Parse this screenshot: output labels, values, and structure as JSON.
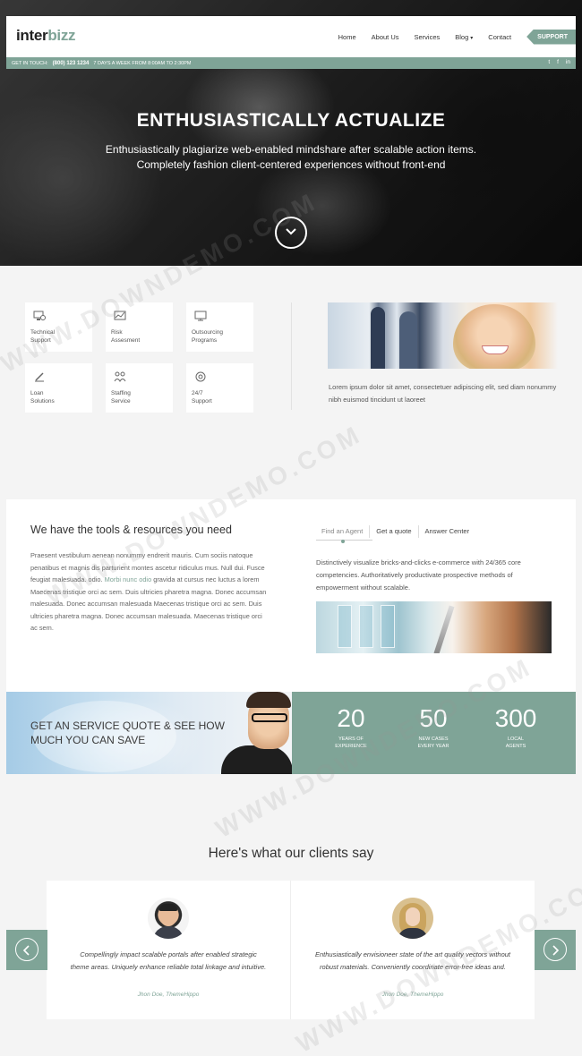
{
  "brand": {
    "logo_main": "inter",
    "logo_accent": "bizz",
    "accent_color": "#7fa497"
  },
  "nav": {
    "items": [
      "Home",
      "About Us",
      "Services",
      "Blog",
      "Contact"
    ],
    "blog_caret": "▾",
    "support_label": "SUPPORT"
  },
  "topbar": {
    "get_in_touch": "GET IN TOUCH:",
    "phone": "(800) 123 1234",
    "hours": "7 DAYS A WEEK FROM 8:00AM TO 2:30PM",
    "social": [
      "twitter-icon",
      "facebook-icon",
      "linkedin-icon"
    ],
    "social_glyphs": [
      "t",
      "f",
      "in"
    ]
  },
  "hero": {
    "title": "ENTHUSIASTICALLY ACTUALIZE",
    "subtitle_line1": "Enthusiastically plagiarize web-enabled mindshare after scalable action items.",
    "subtitle_line2": "Completely fashion client-centered experiences without front-end"
  },
  "services": {
    "cards": [
      {
        "label": "Technical\nSupport",
        "icon": "monitor-support-icon"
      },
      {
        "label": "Risk\nAssesment",
        "icon": "chart-icon"
      },
      {
        "label": "Outsourcing\nPrograms",
        "icon": "screen-icon"
      },
      {
        "label": "Loan\nSolutions",
        "icon": "pen-icon"
      },
      {
        "label": "Staffing\nService",
        "icon": "people-icon"
      },
      {
        "label": "24/7\nSupport",
        "icon": "lifebuoy-icon"
      }
    ],
    "text": "Lorem ipsum dolor sit amet, consectetuer adipiscing elit, sed diam nonummy nibh euismod tincidunt ut laoreet"
  },
  "tools": {
    "heading": "We have the tools & resources you need",
    "para_before_link": "Praesent vestibulum aenean nonummy endrerit mauris. Cum sociis natoque penatibus et magnis dis parturient montes ascetur ridiculus mus. Null dui. Fusce feugiat malesuada. odio. ",
    "para_link": "Morbi nunc odio",
    "para_after_link": " gravida at cursus nec luctus a lorem Maecenas tristique orci ac sem. Duis ultricies pharetra magna. Donec accumsan malesuada. Donec accumsan malesuada Maecenas tristique orci ac sem. Duis ultricies pharetra magna. Donec accumsan malesuada. Maecenas tristique orci ac sem.",
    "tabs": [
      "Find an Agent",
      "Get a quote",
      "Answer Center"
    ],
    "tab_text": "Distinctively visualize bricks-and-clicks e-commerce with 24/365 core competencies. Authoritatively productivate prospective methods of empowerment without scalable."
  },
  "quote": {
    "text": "GET AN SERVICE QUOTE & SEE HOW MUCH YOU CAN SAVE"
  },
  "stats": [
    {
      "number": "20",
      "label": "YEARS OF\nEXPERIENCE"
    },
    {
      "number": "50",
      "label": "NEW CASES\nEVERY YEAR"
    },
    {
      "number": "300",
      "label": "LOCAL\nAGENTS"
    }
  ],
  "testimonials": {
    "heading": "Here's what our clients say",
    "items": [
      {
        "quote": "Compellingly impact scalable portals after enabled strategic theme areas. Uniquely enhance reliable total linkage and intuitive.",
        "author": "Jhon Doe, ThemeHippo"
      },
      {
        "quote": "Enthusiastically envisioneer state of the art quality vectors without robust materials. Conveniently coordinate error-free ideas and.",
        "author": "Jhon Doe, ThemeHippo"
      }
    ]
  },
  "watermark": "WWW.DOWNDEMO.COM"
}
